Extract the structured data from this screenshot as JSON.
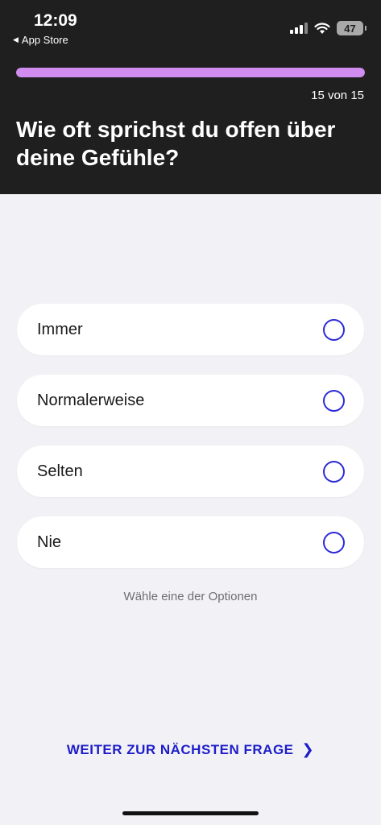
{
  "status_bar": {
    "time": "12:09",
    "back_label": "App Store",
    "battery": "47",
    "icons": [
      "signal-icon",
      "wifi-icon",
      "battery-icon"
    ]
  },
  "progress": {
    "fraction": 1.0,
    "label": "15 von 15",
    "color": "#d18cf0"
  },
  "question": "Wie oft sprichst du offen über deine Gefühle?",
  "options": [
    {
      "label": "Immer",
      "selected": false
    },
    {
      "label": "Normalerweise",
      "selected": false
    },
    {
      "label": "Selten",
      "selected": false
    },
    {
      "label": "Nie",
      "selected": false
    }
  ],
  "hint": "Wähle eine der Optionen",
  "next_button": {
    "label": "WEITER ZUR NÄCHSTEN FRAGE",
    "icon": "chevron-right-icon"
  },
  "colors": {
    "accent": "#1d1dc9",
    "header_bg": "#1f1f1f"
  }
}
